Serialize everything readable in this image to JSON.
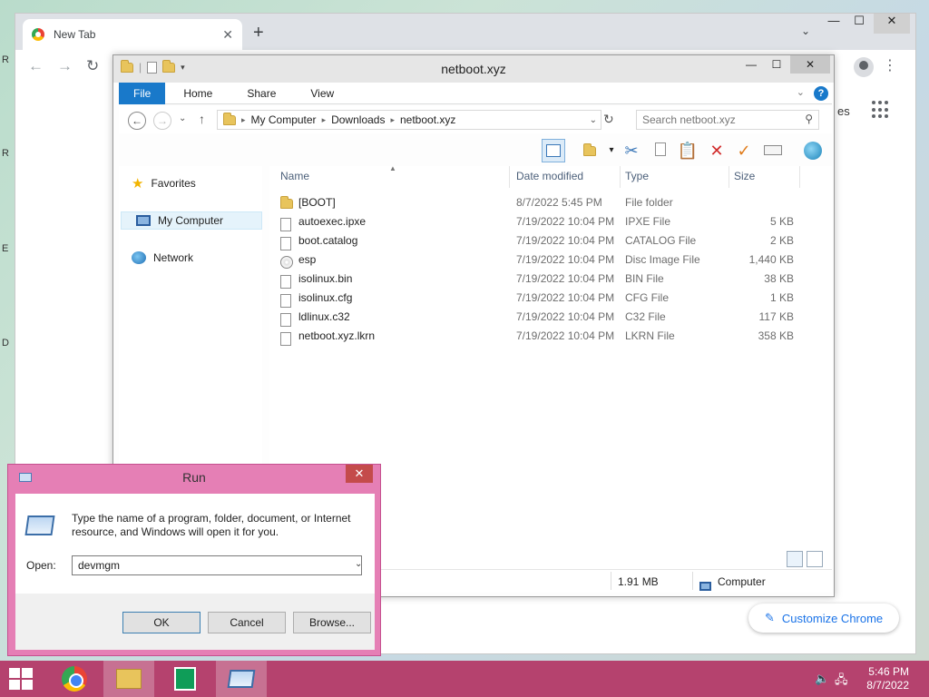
{
  "desktop": {
    "edge_letters": [
      "R",
      "R",
      "E",
      "D"
    ]
  },
  "chrome": {
    "tab_title": "New Tab",
    "tab_close": "✕",
    "new_tab": "+",
    "tab_search": "⌄",
    "min": "—",
    "max": "☐",
    "close": "✕",
    "back": "←",
    "forward": "→",
    "reload": "↻",
    "kebab": "⋮",
    "peek_text": "es",
    "customize_label": "Customize Chrome",
    "accent": "#1a73e8"
  },
  "explorer": {
    "title": "netboot.xyz",
    "min": "—",
    "max": "☐",
    "close": "✕",
    "ribbon": {
      "file": "File",
      "tabs": [
        "Home",
        "Share",
        "View"
      ],
      "help": "?",
      "chev": "⌄"
    },
    "address": {
      "crumbs": [
        "My Computer",
        "Downloads",
        "netboot.xyz"
      ],
      "sep": "▸",
      "dd": "⌄",
      "refresh": "↻",
      "back": "←",
      "forward": "→",
      "recent": "⌄",
      "up": "↑"
    },
    "search_placeholder": "Search netboot.xyz",
    "search_icon": "⚲",
    "nav": {
      "favorites": "Favorites",
      "my_computer": "My Computer",
      "network": "Network"
    },
    "columns": {
      "name": "Name",
      "date": "Date modified",
      "type": "Type",
      "size": "Size"
    },
    "sort_indicator": "▲",
    "files": [
      {
        "name": "[BOOT]",
        "date": "8/7/2022 5:45 PM",
        "type": "File folder",
        "size": "",
        "icon": "folder"
      },
      {
        "name": "autoexec.ipxe",
        "date": "7/19/2022 10:04 PM",
        "type": "IPXE File",
        "size": "5 KB",
        "icon": "doc"
      },
      {
        "name": "boot.catalog",
        "date": "7/19/2022 10:04 PM",
        "type": "CATALOG File",
        "size": "2 KB",
        "icon": "doc"
      },
      {
        "name": "esp",
        "date": "7/19/2022 10:04 PM",
        "type": "Disc Image File",
        "size": "1,440 KB",
        "icon": "disc"
      },
      {
        "name": "isolinux.bin",
        "date": "7/19/2022 10:04 PM",
        "type": "BIN File",
        "size": "38 KB",
        "icon": "doc"
      },
      {
        "name": "isolinux.cfg",
        "date": "7/19/2022 10:04 PM",
        "type": "CFG File",
        "size": "1 KB",
        "icon": "doc"
      },
      {
        "name": "ldlinux.c32",
        "date": "7/19/2022 10:04 PM",
        "type": "C32 File",
        "size": "117 KB",
        "icon": "doc"
      },
      {
        "name": "netboot.xyz.lkrn",
        "date": "7/19/2022 10:04 PM",
        "type": "LKRN File",
        "size": "358 KB",
        "icon": "doc"
      }
    ],
    "status": {
      "size": "1.91 MB",
      "location": "Computer"
    }
  },
  "run": {
    "title": "Run",
    "close": "✕",
    "description": "Type the name of a program, folder, document, or Internet resource, and Windows will open it for you.",
    "open_label": "Open:",
    "open_value": "devmgm",
    "dd": "⌄",
    "ok": "OK",
    "cancel": "Cancel",
    "browse": "Browse..."
  },
  "taskbar": {
    "time": "5:46 PM",
    "date": "8/7/2022",
    "volume_icon": "🔈",
    "network_icon": "🖧",
    "color": "#b5426e"
  }
}
